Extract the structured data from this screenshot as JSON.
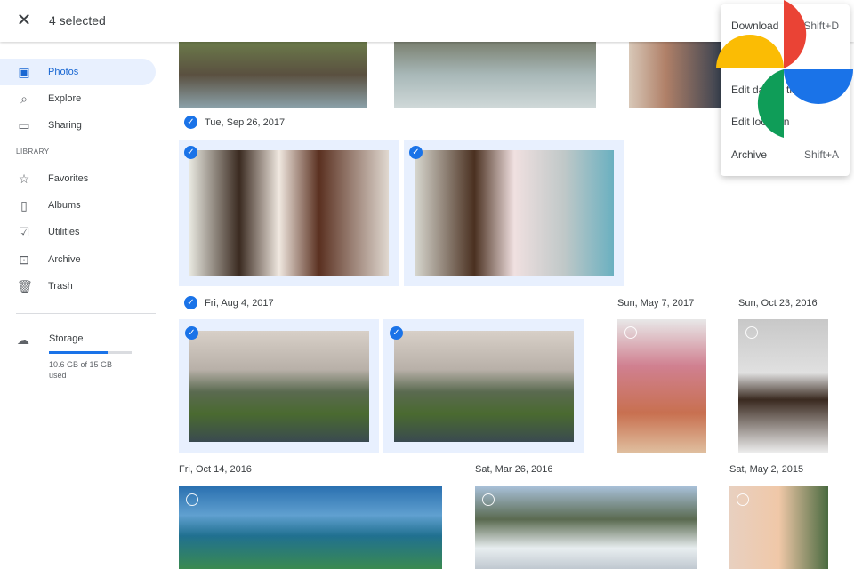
{
  "header": {
    "close_icon": "close-icon",
    "selected_label": "4 selected"
  },
  "sidebar": {
    "items": [
      {
        "label": "Photos",
        "icon": "photo-icon",
        "active": true
      },
      {
        "label": "Explore",
        "icon": "search-icon"
      },
      {
        "label": "Sharing",
        "icon": "chat-icon"
      }
    ],
    "library_heading": "LIBRARY",
    "library_items": [
      {
        "label": "Favorites",
        "icon": "star-icon"
      },
      {
        "label": "Albums",
        "icon": "album-icon"
      },
      {
        "label": "Utilities",
        "icon": "checkbox-icon"
      },
      {
        "label": "Archive",
        "icon": "archive-icon"
      },
      {
        "label": "Trash",
        "icon": "trash-icon"
      }
    ],
    "storage": {
      "label": "Storage",
      "usage": "10.6 GB of 15 GB used",
      "used_fraction": 0.707,
      "bar_color": "#1a73e8"
    }
  },
  "groups": [
    {
      "date": "Tue, Sep 26, 2017",
      "selected": true
    },
    {
      "date": "Fri, Aug 4, 2017",
      "selected": true
    },
    {
      "date": "Sun, May 7, 2017",
      "selected": false
    },
    {
      "date": "Sun, Oct 23, 2016",
      "selected": false
    },
    {
      "date": "Fri, Oct 14, 2016",
      "selected": false
    },
    {
      "date": "Sat, Mar 26, 2016",
      "selected": false
    },
    {
      "date": "Sat, May 2, 2015",
      "selected": false
    }
  ],
  "menu": {
    "items": [
      {
        "label": "Download",
        "shortcut": "Shift+D"
      },
      {
        "label": "Edit date & time",
        "shortcut": ""
      },
      {
        "label": "Edit location",
        "shortcut": ""
      },
      {
        "label": "Archive",
        "shortcut": "Shift+A"
      }
    ]
  },
  "colors": {
    "accent": "#1a73e8",
    "selected_bg": "#e8f0fe",
    "logo": [
      "#ea4335",
      "#fbbc04",
      "#34a853",
      "#4285f4"
    ]
  }
}
